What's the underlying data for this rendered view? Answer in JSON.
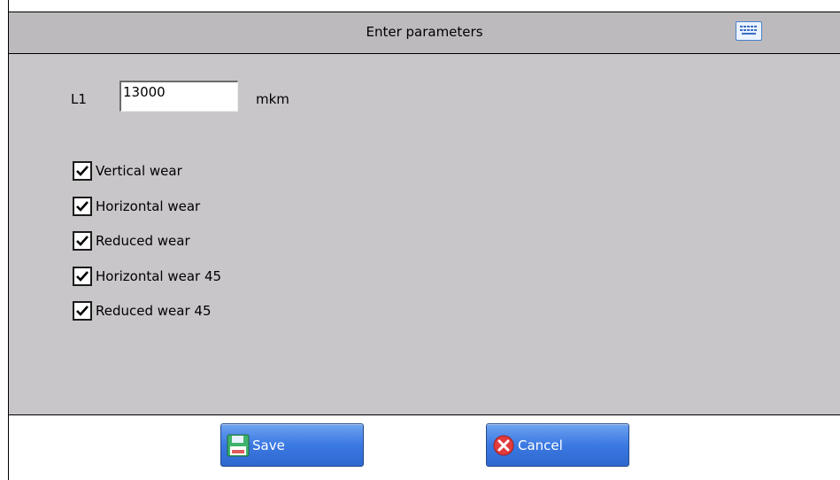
{
  "dialog": {
    "title": "Enter parameters",
    "keyboard_icon": "keyboard-icon"
  },
  "params": {
    "l1_label": "L1",
    "l1_value": "13000",
    "l1_unit": "mkm"
  },
  "options": [
    {
      "label": "Vertical wear",
      "checked": true
    },
    {
      "label": "Horizontal wear",
      "checked": true
    },
    {
      "label": "Reduced wear",
      "checked": true
    },
    {
      "label": "Horizontal wear 45",
      "checked": true
    },
    {
      "label": "Reduced wear 45",
      "checked": true
    }
  ],
  "buttons": {
    "save_label": "Save",
    "save_icon": "floppy-disk-icon",
    "cancel_label": "Cancel",
    "cancel_icon": "red-x-icon"
  }
}
